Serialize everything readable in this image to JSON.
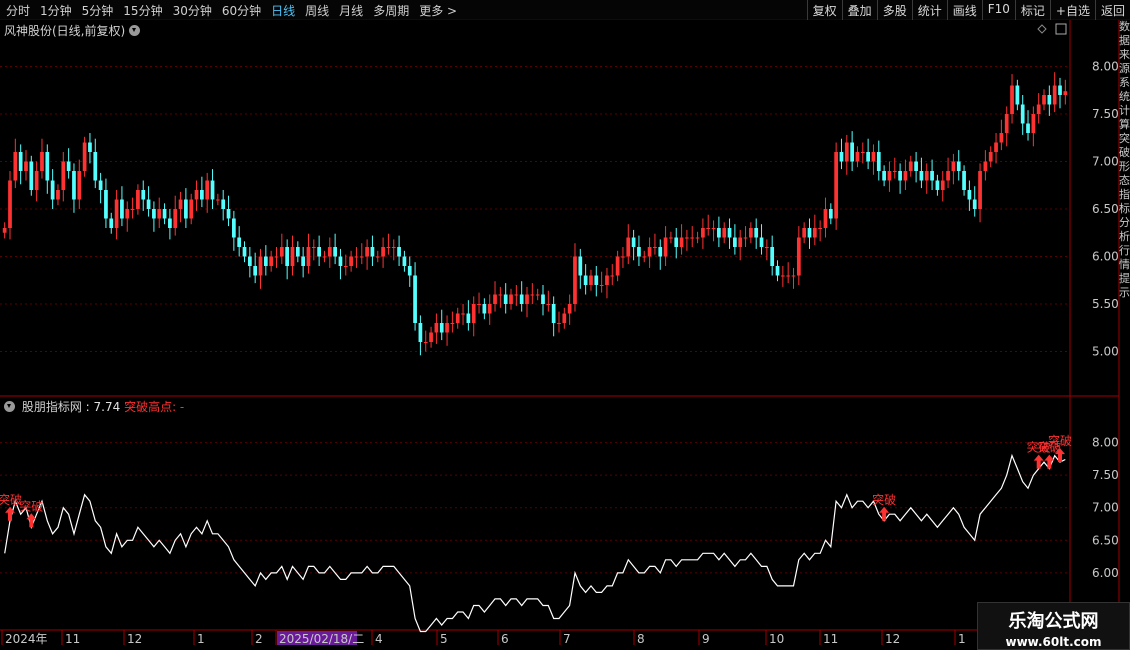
{
  "toolbar": {
    "tabs": [
      "分时",
      "1分钟",
      "5分钟",
      "15分钟",
      "30分钟",
      "60分钟",
      "日线",
      "周线",
      "月线",
      "多周期",
      "更多 >"
    ],
    "active_tab": "日线",
    "tools": [
      "复权",
      "叠加",
      "多股",
      "统计",
      "画线",
      "F10",
      "标记",
      "+自选",
      "返回"
    ]
  },
  "price_panel": {
    "title": "风神股份(日线,前复权)",
    "y_ticks": [
      "8.00",
      "7.50",
      "7.00",
      "6.50",
      "6.00",
      "5.50",
      "5.00"
    ]
  },
  "indicator_panel": {
    "title": "股朋指标网",
    "value": ": 7.74",
    "series_label": "突破高点: -",
    "y_ticks": [
      "8.00",
      "7.50",
      "7.00",
      "6.50",
      "6.00"
    ],
    "signal_label": "突破"
  },
  "time_axis": {
    "labels": [
      "2024年",
      "11",
      "12",
      "1",
      "2",
      "2025/02/18/二",
      "4",
      "5",
      "6",
      "7",
      "8",
      "9",
      "10",
      "11",
      "12",
      "1"
    ],
    "highlighted": "2025/02/18/二"
  },
  "right_strip_text": "数据来源系统计算突破形态指标分析行情提示",
  "watermark": {
    "title": "乐淘公式网",
    "url": "www.60lt.com"
  },
  "colors": {
    "up": "#ff3232",
    "down": "#54ffff",
    "line": "#ffffff",
    "grid": "#5a0000",
    "highlight": "#6a1b9a",
    "accent": "#4fc3f7"
  },
  "chart_data": [
    {
      "type": "candlestick",
      "title": "风神股份(日线,前复权)",
      "ylim": [
        4.7,
        8.3
      ],
      "x_range": [
        "2024-10",
        "2025-02"
      ],
      "close": [
        6.3,
        6.8,
        7.1,
        6.9,
        7.0,
        6.7,
        6.9,
        7.1,
        6.8,
        6.6,
        6.7,
        7.0,
        6.9,
        6.6,
        6.9,
        7.2,
        7.1,
        6.8,
        6.7,
        6.4,
        6.3,
        6.6,
        6.4,
        6.5,
        6.5,
        6.7,
        6.6,
        6.5,
        6.4,
        6.5,
        6.4,
        6.3,
        6.5,
        6.6,
        6.4,
        6.6,
        6.7,
        6.6,
        6.8,
        6.6,
        6.6,
        6.5,
        6.4,
        6.2,
        6.1,
        6.0,
        5.9,
        5.8,
        6.0,
        5.9,
        6.0,
        6.0,
        6.1,
        5.9,
        6.1,
        6.0,
        5.9,
        6.1,
        6.1,
        6.0,
        6.0,
        6.1,
        6.0,
        5.9,
        5.9,
        6.0,
        6.0,
        6.0,
        6.1,
        6.0,
        6.0,
        6.1,
        6.1,
        6.1,
        6.0,
        5.9,
        5.8,
        5.3,
        5.1,
        5.1,
        5.2,
        5.3,
        5.2,
        5.3,
        5.3,
        5.4,
        5.4,
        5.3,
        5.5,
        5.5,
        5.4,
        5.5,
        5.6,
        5.6,
        5.5,
        5.6,
        5.6,
        5.5,
        5.6,
        5.6,
        5.6,
        5.5,
        5.5,
        5.3,
        5.3,
        5.4,
        5.5,
        6.0,
        5.8,
        5.7,
        5.8,
        5.7,
        5.7,
        5.8,
        5.8,
        6.0,
        6.0,
        6.2,
        6.1,
        6.0,
        6.0,
        6.1,
        6.1,
        6.0,
        6.2,
        6.2,
        6.1,
        6.2,
        6.2,
        6.2,
        6.2,
        6.3,
        6.3,
        6.3,
        6.2,
        6.3,
        6.2,
        6.1,
        6.2,
        6.2,
        6.3,
        6.2,
        6.1,
        6.1,
        5.9,
        5.8,
        5.8,
        5.8,
        5.8,
        6.2,
        6.3,
        6.2,
        6.3,
        6.3,
        6.5,
        6.4,
        7.1,
        7.0,
        7.2,
        7.0,
        7.1,
        7.1,
        7.0,
        7.1,
        6.9,
        6.8,
        6.9,
        6.9,
        6.8,
        6.9,
        7.0,
        6.9,
        6.8,
        6.9,
        6.8,
        6.7,
        6.8,
        6.9,
        7.0,
        6.9,
        6.7,
        6.6,
        6.5,
        6.9,
        7.0,
        7.1,
        7.2,
        7.3,
        7.5,
        7.8,
        7.6,
        7.4,
        7.3,
        7.5,
        7.6,
        7.7,
        7.6,
        7.8,
        7.7,
        7.74
      ],
      "x_labels": [
        "2024年",
        "11",
        "12",
        "1",
        "2",
        "2025/02/18/二",
        "4",
        "5",
        "6",
        "7",
        "8",
        "9",
        "10",
        "11",
        "12",
        "1"
      ]
    },
    {
      "type": "line",
      "title": "股朋指标网",
      "ylim": [
        5.2,
        8.5
      ],
      "signal_label": "突破",
      "signal_indices": [
        1,
        5,
        165,
        194,
        196,
        198
      ]
    }
  ]
}
